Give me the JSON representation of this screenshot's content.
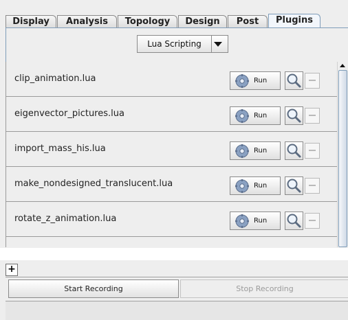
{
  "tabs": [
    {
      "label": "Display",
      "active": false
    },
    {
      "label": "Analysis",
      "active": false
    },
    {
      "label": "Topology",
      "active": false
    },
    {
      "label": "Design",
      "active": false
    },
    {
      "label": "Post",
      "active": false
    },
    {
      "label": "Plugins",
      "active": true
    }
  ],
  "plugin_selector": {
    "selected": "Lua Scripting"
  },
  "scripts": [
    {
      "name": "clip_animation.lua",
      "run_label": "Run"
    },
    {
      "name": "eigenvector_pictures.lua",
      "run_label": "Run"
    },
    {
      "name": "import_mass_his.lua",
      "run_label": "Run"
    },
    {
      "name": "make_nondesigned_translucent.lua",
      "run_label": "Run"
    },
    {
      "name": "rotate_z_animation.lua",
      "run_label": "Run"
    }
  ],
  "recording": {
    "add_symbol": "+",
    "start_label": "Start Recording",
    "stop_label": "Stop Recording",
    "stop_enabled": false
  },
  "icons": {
    "run": "gear-icon",
    "inspect": "magnifier-icon",
    "remove": "minus-icon",
    "dropdown": "chevron-down-icon"
  },
  "colors": {
    "active_tab_border": "#7f9db9",
    "disabled_text": "#9b9b9b"
  }
}
